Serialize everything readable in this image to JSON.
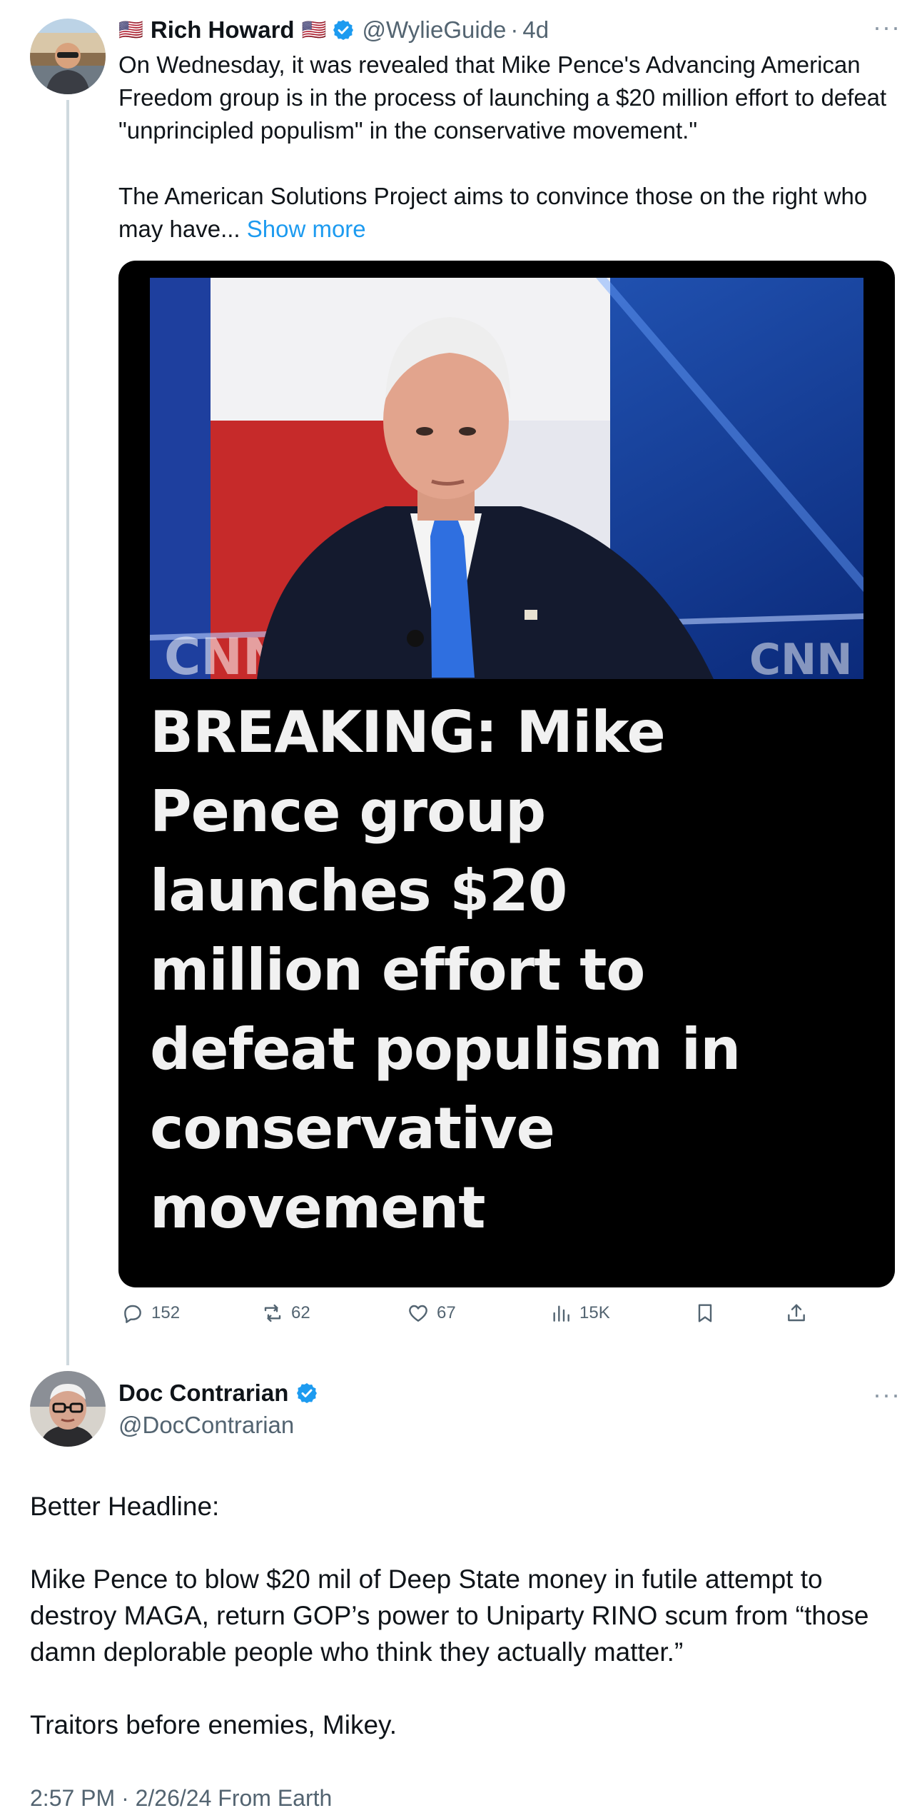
{
  "tweet1": {
    "flag_emoji": "🇺🇸",
    "display_name": "Rich Howard",
    "handle": "@WylieGuide",
    "time_separator": "·",
    "time": "4d",
    "more_label": "···",
    "paragraph1": "On Wednesday, it was revealed that Mike Pence's Advancing American Freedom group is in the process of launching a $20 million effort to defeat \"unprincipled populism\" in the conservative movement.\"",
    "paragraph2": "The American Solutions Project aims to convince those on the right who may have...",
    "show_more": "Show more",
    "media_headline": "BREAKING: Mike\nPence group\nlaunches $20\nmillion effort to\ndefeat populism in\nconservative\nmovement",
    "actions": {
      "replies": "152",
      "reposts": "62",
      "likes": "67",
      "views": "15K"
    }
  },
  "tweet2": {
    "display_name": "Doc Contrarian",
    "handle": "@DocContrarian",
    "more_label": "···",
    "paragraph1": "Better Headline:",
    "paragraph2": "Mike Pence to blow $20 mil of Deep State money in futile attempt to destroy MAGA, return GOP’s power to Uniparty RINO scum from “those damn deplorable people who think they actually matter.”",
    "paragraph3": "Traitors before enemies, Mikey.",
    "meta": "2:57 PM · 2/26/24 From Earth"
  },
  "icons": {
    "verified": "verified-badge-icon",
    "reply": "reply-icon",
    "repost": "repost-icon",
    "like": "heart-icon",
    "views": "views-icon",
    "bookmark": "bookmark-icon",
    "share": "share-icon"
  },
  "colors": {
    "accent": "#1d9bf0",
    "secondary_text": "#536471",
    "thread_line": "#cfd9de",
    "media_background": "#000000",
    "headline_text": "#f1f1f1"
  }
}
